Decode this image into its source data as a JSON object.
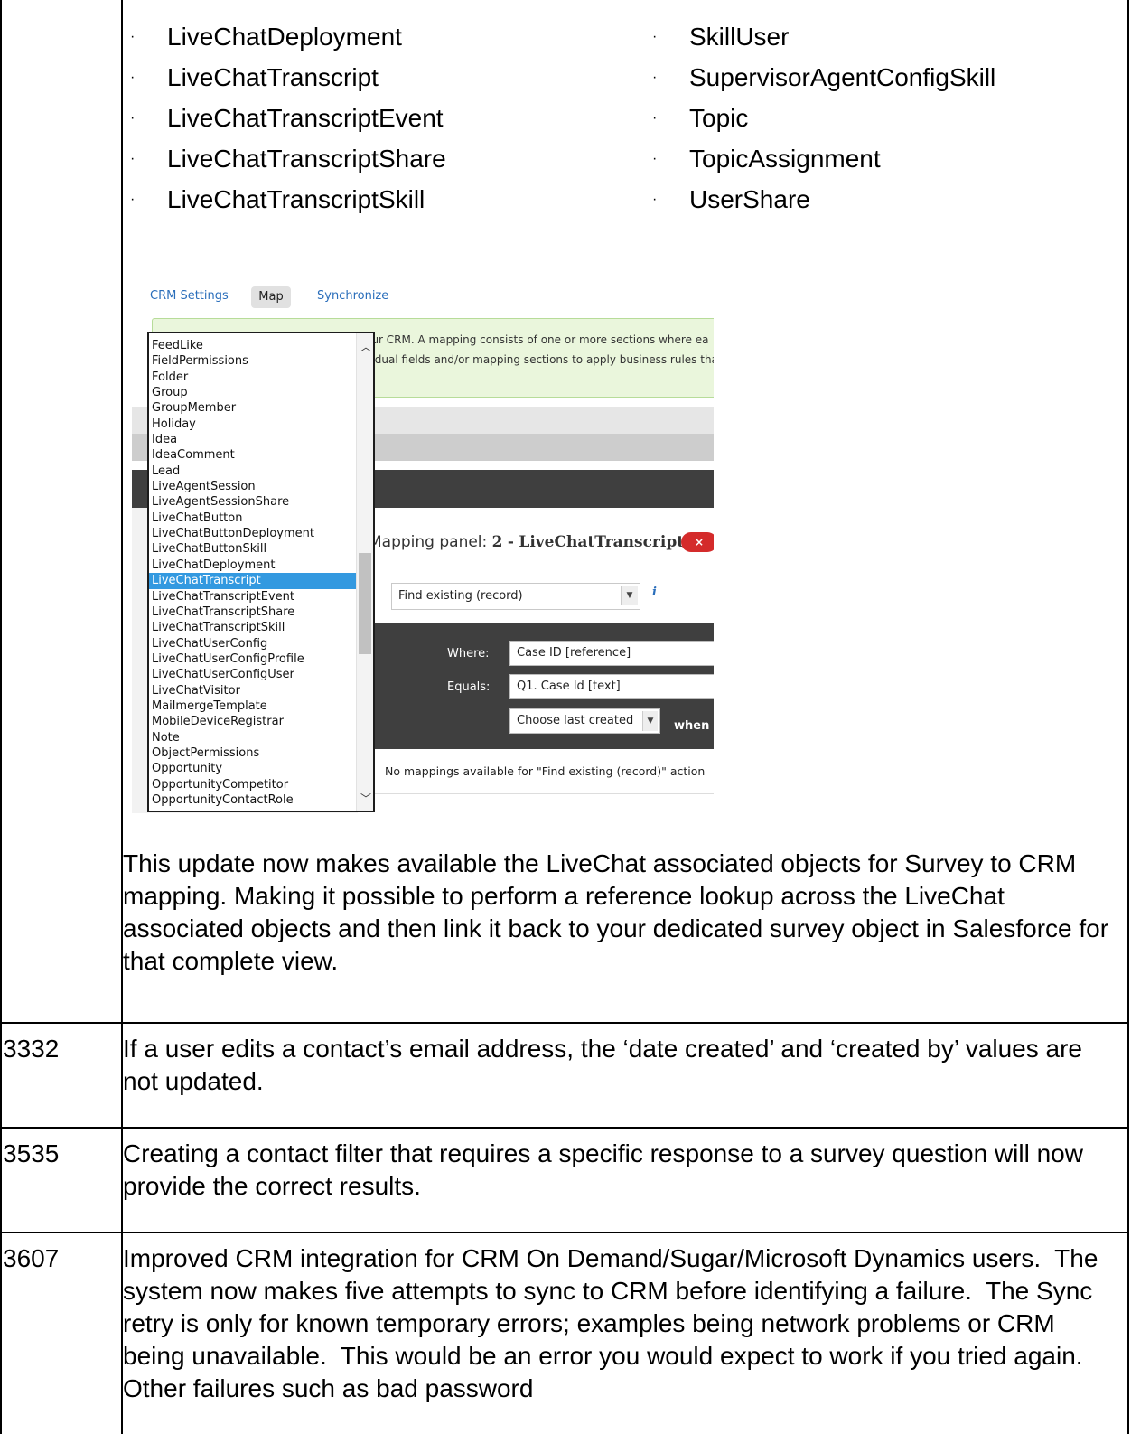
{
  "bullets_left": [
    "LiveChatDeployment",
    "LiveChatTranscript",
    "LiveChatTranscriptEvent",
    "LiveChatTranscriptShare",
    "LiveChatTranscriptSkill"
  ],
  "bullets_right": [
    "SkillUser",
    "SupervisorAgentConfigSkill",
    "Topic",
    "TopicAssignment",
    "UserShare"
  ],
  "bullet_glyph": "·",
  "screenshot": {
    "tabs": {
      "crm_settings": "CRM Settings",
      "map": "Map",
      "synchronize": "Synchronize"
    },
    "info_line1": "your CRM. A mapping consists of one or more sections where ea",
    "info_line2": "ividual fields and/or mapping sections to apply business rules tha",
    "panel_title_prefix": "Mapping panel:",
    "panel_number": "2",
    "panel_object": "LiveChatTranscript",
    "close_label": "×",
    "action_select": "Find existing (record)",
    "info_icon": "i",
    "where_label": "Where:",
    "where_value": "Case ID [reference]",
    "equals_label": "Equals:",
    "equals_value": "Q1. Case Id [text]",
    "choose_value": "Choose last created",
    "when_text": "when n",
    "no_mappings": "No mappings available for \"Find existing (record)\" action",
    "dropdown_items": [
      "FeedLike",
      "FieldPermissions",
      "Folder",
      "Group",
      "GroupMember",
      "Holiday",
      "Idea",
      "IdeaComment",
      "Lead",
      "LiveAgentSession",
      "LiveAgentSessionShare",
      "LiveChatButton",
      "LiveChatButtonDeployment",
      "LiveChatButtonSkill",
      "LiveChatDeployment",
      "LiveChatTranscript",
      "LiveChatTranscriptEvent",
      "LiveChatTranscriptShare",
      "LiveChatTranscriptSkill",
      "LiveChatUserConfig",
      "LiveChatUserConfigProfile",
      "LiveChatUserConfigUser",
      "LiveChatVisitor",
      "MailmergeTemplate",
      "MobileDeviceRegistrar",
      "Note",
      "ObjectPermissions",
      "Opportunity",
      "OpportunityCompetitor",
      "OpportunityContactRole"
    ],
    "dropdown_selected": "LiveChatTranscript",
    "colors": {
      "link": "#2a6ebb",
      "selected": "#3399e0",
      "close": "#d42b2b",
      "info_box": "#eaf6dc",
      "dark_panel": "#3f3f3f"
    }
  },
  "update_paragraph": "This update now makes available the LiveChat associated objects for Survey to CRM mapping. Making it possible to perform a reference lookup across the LiveChat associated objects and then link it back to your dedicated survey object in Salesforce for that complete view.",
  "rows": [
    {
      "id": "3332",
      "text": "If a user edits a contact’s email address, the ‘date created’ and ‘created by’ values are not updated."
    },
    {
      "id": "3535",
      "text": "Creating a contact filter that requires a specific response to a survey question will now provide the correct results."
    },
    {
      "id": "3607",
      "text": "Improved CRM integration for CRM On Demand/Sugar/Microsoft Dynamics users.  The system now makes five attempts to sync to CRM before identifying a failure.  The Sync retry is only for known temporary errors; examples being network problems or CRM being unavailable.  This would be an error you would expect to work if you tried again.  Other failures such as bad password"
    }
  ]
}
